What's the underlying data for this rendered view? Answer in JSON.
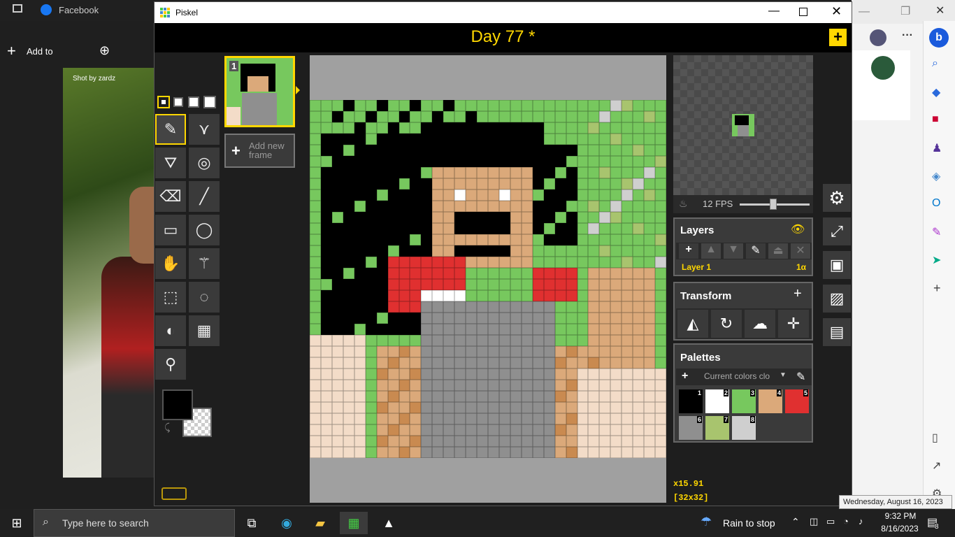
{
  "background_app": {
    "tab_title": "Facebook",
    "add_to_label": "Add to",
    "photo_watermark": "Shot by zardz"
  },
  "window": {
    "title": "Piskel",
    "doc_title": "Day 77 *"
  },
  "frames": {
    "frame_number": "1",
    "add_frame_label": "Add new frame"
  },
  "preview": {
    "fps_label": "12 FPS",
    "fps": 12
  },
  "layers": {
    "title": "Layers",
    "items": [
      {
        "name": "Layer 1",
        "opacity": "1α"
      }
    ]
  },
  "transform": {
    "title": "Transform"
  },
  "palettes": {
    "title": "Palettes",
    "selected": "Current colors clo",
    "swatches": [
      {
        "n": "1",
        "color": "#000000"
      },
      {
        "n": "2",
        "color": "#ffffff"
      },
      {
        "n": "3",
        "color": "#77c85e"
      },
      {
        "n": "4",
        "color": "#dba97a"
      },
      {
        "n": "5",
        "color": "#e03030"
      },
      {
        "n": "6",
        "color": "#8f8f8f"
      },
      {
        "n": "7",
        "color": "#a8c46e"
      },
      {
        "n": "8",
        "color": "#cfcfcf"
      }
    ]
  },
  "canvas_info": {
    "zoom": "x15.91",
    "size": "[32x32]"
  },
  "colors": {
    "primary": "#000000",
    "accent": "#ffd700"
  },
  "tooltip": "Wednesday, August 16, 2023",
  "taskbar": {
    "search_placeholder": "Type here to search",
    "weather": "Rain to stop",
    "time": "9:32 PM",
    "date": "8/16/2023",
    "notifications": "8"
  }
}
